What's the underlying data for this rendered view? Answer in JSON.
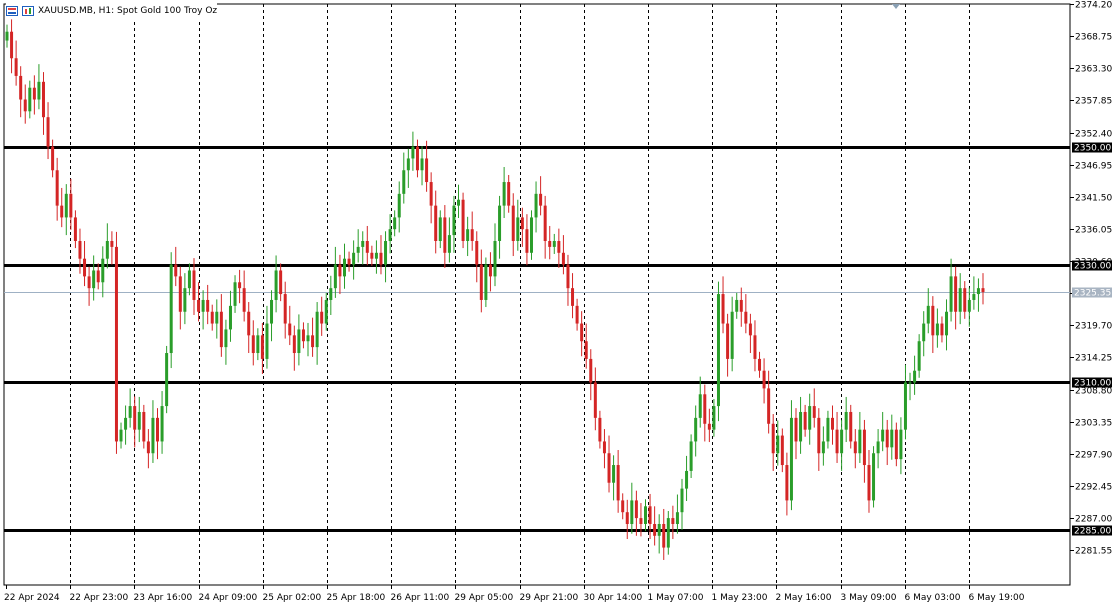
{
  "header": {
    "title": "XAUUSD.MB, H1:  Spot Gold 100 Troy Oz",
    "icons": [
      "trade-panel-icon",
      "depth-of-market-icon"
    ]
  },
  "colors": {
    "bull": "#2a9d2a",
    "bear": "#d42525",
    "level_line": "#000000",
    "price_line": "#9fb1c4",
    "grid": "#000000",
    "price_tag_bg": "#000000",
    "current_tag_bg": "#a8b4c2"
  },
  "chart_data": {
    "type": "candlestick",
    "symbol": "XAUUSD.MB",
    "timeframe": "H1",
    "ylim": [
      2276.5,
      2374.2
    ],
    "y_ticks": [
      "2374.20",
      "2368.75",
      "2363.30",
      "2357.85",
      "2352.40",
      "2346.95",
      "2341.50",
      "2336.05",
      "2330.60",
      "2325.15",
      "2319.70",
      "2314.25",
      "2308.80",
      "2303.35",
      "2297.90",
      "2292.45",
      "2287.00",
      "2281.55"
    ],
    "x_labels": [
      "22 Apr 2024",
      "22 Apr 23:00",
      "23 Apr 16:00",
      "24 Apr 09:00",
      "25 Apr 02:00",
      "25 Apr 18:00",
      "26 Apr 11:00",
      "29 Apr 05:00",
      "29 Apr 21:00",
      "30 Apr 14:00",
      "1 May 07:00",
      "1 May 23:00",
      "2 May 16:00",
      "3 May 09:00",
      "6 May 03:00",
      "6 May 19:00"
    ],
    "horizontal_levels": [
      {
        "value": 2350.0,
        "label": "2350.00"
      },
      {
        "value": 2330.0,
        "label": "2330.00"
      },
      {
        "value": 2310.0,
        "label": "2310.00"
      },
      {
        "value": 2285.0,
        "label": "2285.00"
      }
    ],
    "current_price": {
      "value": 2325.35,
      "label": "2325.35"
    },
    "grid": "vertical dashed at date labels",
    "close": [
      2369.5,
      2365,
      2362,
      2358,
      2356,
      2360,
      2358,
      2361,
      2355,
      2350,
      2346,
      2340,
      2338,
      2342,
      2338,
      2334,
      2331,
      2328,
      2326,
      2329,
      2327,
      2331,
      2334,
      2333,
      2300,
      2302,
      2304,
      2306,
      2302,
      2305,
      2300,
      2298,
      2304,
      2300,
      2306,
      2315,
      2330,
      2328,
      2322,
      2326,
      2329,
      2324,
      2322,
      2324,
      2322,
      2320,
      2322,
      2316,
      2319,
      2323,
      2327,
      2326,
      2322,
      2318,
      2315,
      2318,
      2314,
      2320,
      2324,
      2329,
      2325,
      2320,
      2318,
      2315,
      2319,
      2317,
      2318,
      2316,
      2322,
      2320,
      2324,
      2326,
      2330,
      2328,
      2331,
      2330,
      2332,
      2333,
      2334,
      2332,
      2331,
      2332,
      2330,
      2334,
      2336,
      2338,
      2342,
      2346,
      2348,
      2350,
      2346,
      2348,
      2344,
      2340,
      2334,
      2338,
      2332,
      2335,
      2340,
      2341,
      2334,
      2336,
      2334,
      2330,
      2324,
      2330,
      2328,
      2334,
      2340,
      2344,
      2340,
      2334,
      2338,
      2336,
      2332,
      2338,
      2342,
      2340,
      2334,
      2333,
      2334,
      2332,
      2330,
      2326,
      2323,
      2320,
      2317,
      2314,
      2310,
      2304,
      2300,
      2298,
      2293,
      2296,
      2290,
      2288,
      2286,
      2290,
      2287,
      2286,
      2289,
      2286,
      2284,
      2286,
      2282,
      2287,
      2286,
      2288,
      2292,
      2295,
      2300,
      2304,
      2308,
      2303,
      2302,
      2306,
      2325,
      2320,
      2314,
      2322,
      2324,
      2322,
      2320,
      2318,
      2314,
      2312,
      2309,
      2303,
      2298,
      2301,
      2296,
      2290,
      2304,
      2300,
      2305,
      2302,
      2306,
      2304,
      2298,
      2300,
      2304,
      2302,
      2298,
      2302,
      2305,
      2300,
      2298,
      2302,
      2296,
      2290,
      2298,
      2300,
      2302,
      2299,
      2302,
      2297,
      2302,
      2310,
      2310,
      2312,
      2317,
      2320,
      2323,
      2318,
      2320,
      2318,
      2322,
      2328,
      2322,
      2326,
      2322,
      2324,
      2325,
      2326,
      2325.35
    ],
    "note_empty": ""
  }
}
